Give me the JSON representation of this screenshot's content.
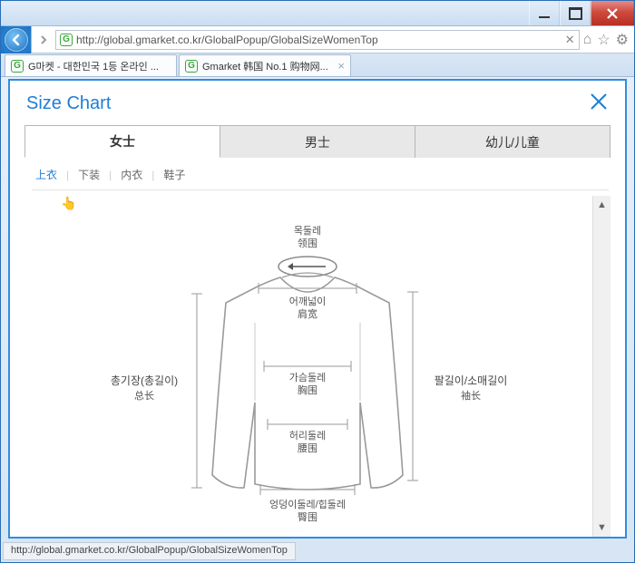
{
  "window": {
    "url": "http://global.gmarket.co.kr/GlobalPopup/GlobalSizeWomenTop",
    "tabs": [
      {
        "label": "G마켓 - 대한민국 1등 온라인 ..."
      },
      {
        "label": "Gmarket 韩国 No.1 购物网..."
      }
    ],
    "status": "http://global.gmarket.co.kr/GlobalPopup/GlobalSizeWomenTop"
  },
  "page": {
    "title": "Size Chart",
    "maintabs": [
      {
        "label": "女士",
        "active": true
      },
      {
        "label": "男士",
        "active": false
      },
      {
        "label": "幼儿/儿童",
        "active": false
      }
    ],
    "subtabs": [
      {
        "label": "上衣",
        "active": true
      },
      {
        "label": "下装",
        "active": false
      },
      {
        "label": "内衣",
        "active": false
      },
      {
        "label": "鞋子",
        "active": false
      }
    ],
    "diagram": {
      "neck_ko": "목둘레",
      "neck_cn": "领围",
      "shoulder_ko": "어깨넓이",
      "shoulder_cn": "肩宽",
      "chest_ko": "가슴둘레",
      "chest_cn": "胸围",
      "waist_ko": "허리둘레",
      "waist_cn": "腰围",
      "hip_ko": "엉덩이둘레/힙둘레",
      "hip_cn": "臀围",
      "length_ko": "총기장(총길이)",
      "length_cn": "总长",
      "sleeve_ko": "팔길이/소매길이",
      "sleeve_cn": "袖长"
    }
  }
}
